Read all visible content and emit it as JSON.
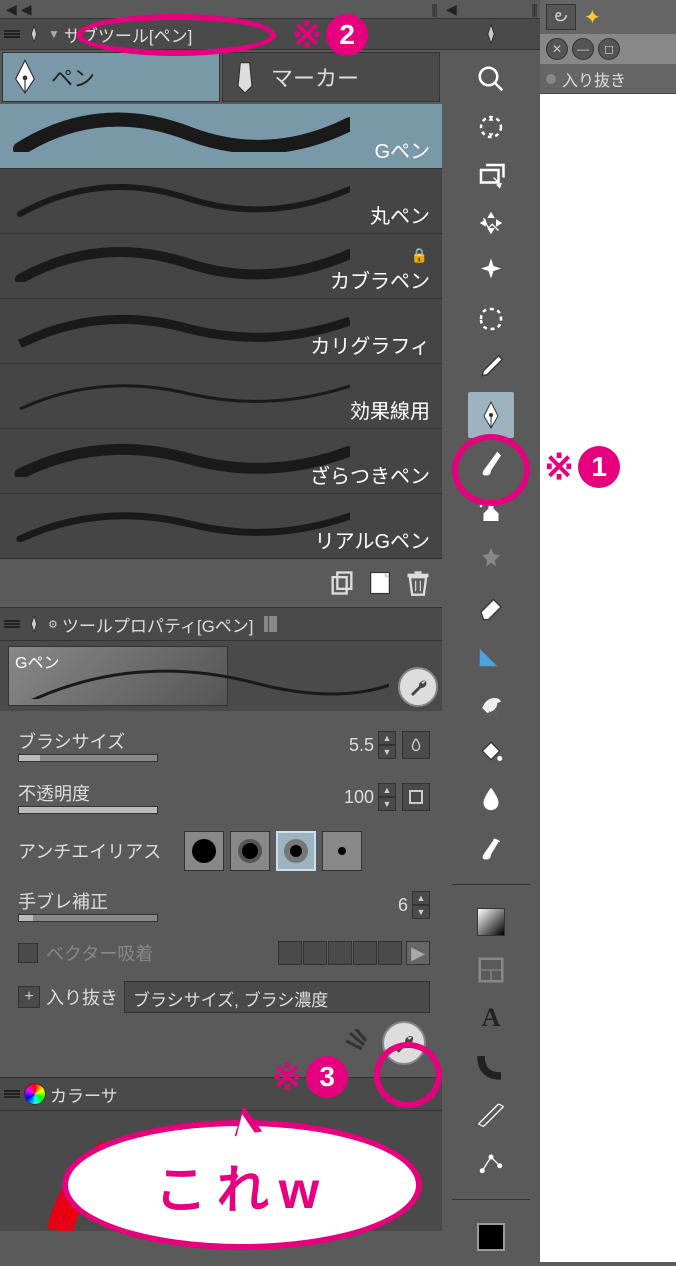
{
  "subtool_panel_title": "サブツール[ペン]",
  "tabs": {
    "pen": "ペン",
    "marker": "マーカー"
  },
  "brushes": [
    {
      "label": "Gペン"
    },
    {
      "label": "丸ペン"
    },
    {
      "label": "カブラペン"
    },
    {
      "label": "カリグラフィ"
    },
    {
      "label": "効果線用"
    },
    {
      "label": "ざらつきペン"
    },
    {
      "label": "リアルGペン"
    }
  ],
  "tool_property_title": "ツールプロパティ[Gペン]",
  "thumb_label": "Gペン",
  "props": {
    "brush_size_label": "ブラシサイズ",
    "brush_size_value": "5.5",
    "opacity_label": "不透明度",
    "opacity_value": "100",
    "antialias_label": "アンチエイリアス",
    "stabilize_label": "手ブレ補正",
    "stabilize_value": "6",
    "vector_label": "ベクター吸着",
    "inout_label": "入り抜き",
    "inout_combo": "ブラシサイズ, ブラシ濃度"
  },
  "color_panel_title": "カラーサ",
  "right_tab_label": "入り抜き",
  "annotations": {
    "a1": "※",
    "n1": "1",
    "a2": "※",
    "n2": "2",
    "a3": "※",
    "n3": "3",
    "speech": "これw"
  },
  "icons": {
    "pen": "pen",
    "marker": "marker",
    "wrench": "wrench"
  }
}
